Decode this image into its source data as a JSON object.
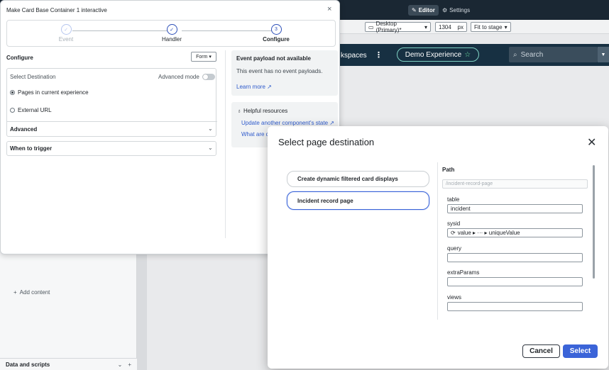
{
  "topbar": {
    "editor_label": "Editor",
    "settings_label": "Settings",
    "device_select": "Desktop (Primary)*",
    "width_value": "1304",
    "width_unit": "px",
    "fit_select": "Fit to stage"
  },
  "nav": {
    "workspaces_text": "kspaces",
    "dots": "⋮",
    "experience_label": "Demo Experience",
    "search_placeholder": "Search"
  },
  "left_panel": {
    "add_content": "Add content",
    "data_scripts": "Data and scripts"
  },
  "interactive_dialog": {
    "title": "Make Card Base Container 1 interactive",
    "close_icon": "×",
    "steps": [
      {
        "label": "Event",
        "num": "✓"
      },
      {
        "label": "Handler",
        "num": "✓"
      },
      {
        "label": "Configure",
        "num": "3"
      }
    ],
    "configure_heading": "Configure",
    "form_select": "Form",
    "select_destination": "Select Destination",
    "advanced_mode": "Advanced mode",
    "options": [
      "Pages in current experience",
      "External URL"
    ],
    "advanced_label": "Advanced",
    "when_to_trigger": "When to trigger",
    "payload_title": "Event payload not available",
    "payload_text": "This event has no event payloads.",
    "learn_more": "Learn more",
    "helpful_resources": "Helpful resources",
    "resource_links": [
      "Update another component's state",
      "What are cl"
    ]
  },
  "modal": {
    "title": "Select page destination",
    "choices": [
      "Create dynamic filtered card displays",
      "Incident record page"
    ],
    "path_label": "Path",
    "path_placeholder": "/incident-record-page",
    "fields": [
      {
        "label": "table",
        "value": "incident"
      },
      {
        "label": "sysid",
        "value": "value ▸ ··· ▸ uniqueValue"
      },
      {
        "label": "query",
        "value": ""
      },
      {
        "label": "extraParams",
        "value": ""
      },
      {
        "label": "views",
        "value": ""
      }
    ],
    "cancel_label": "Cancel",
    "select_label": "Select"
  }
}
